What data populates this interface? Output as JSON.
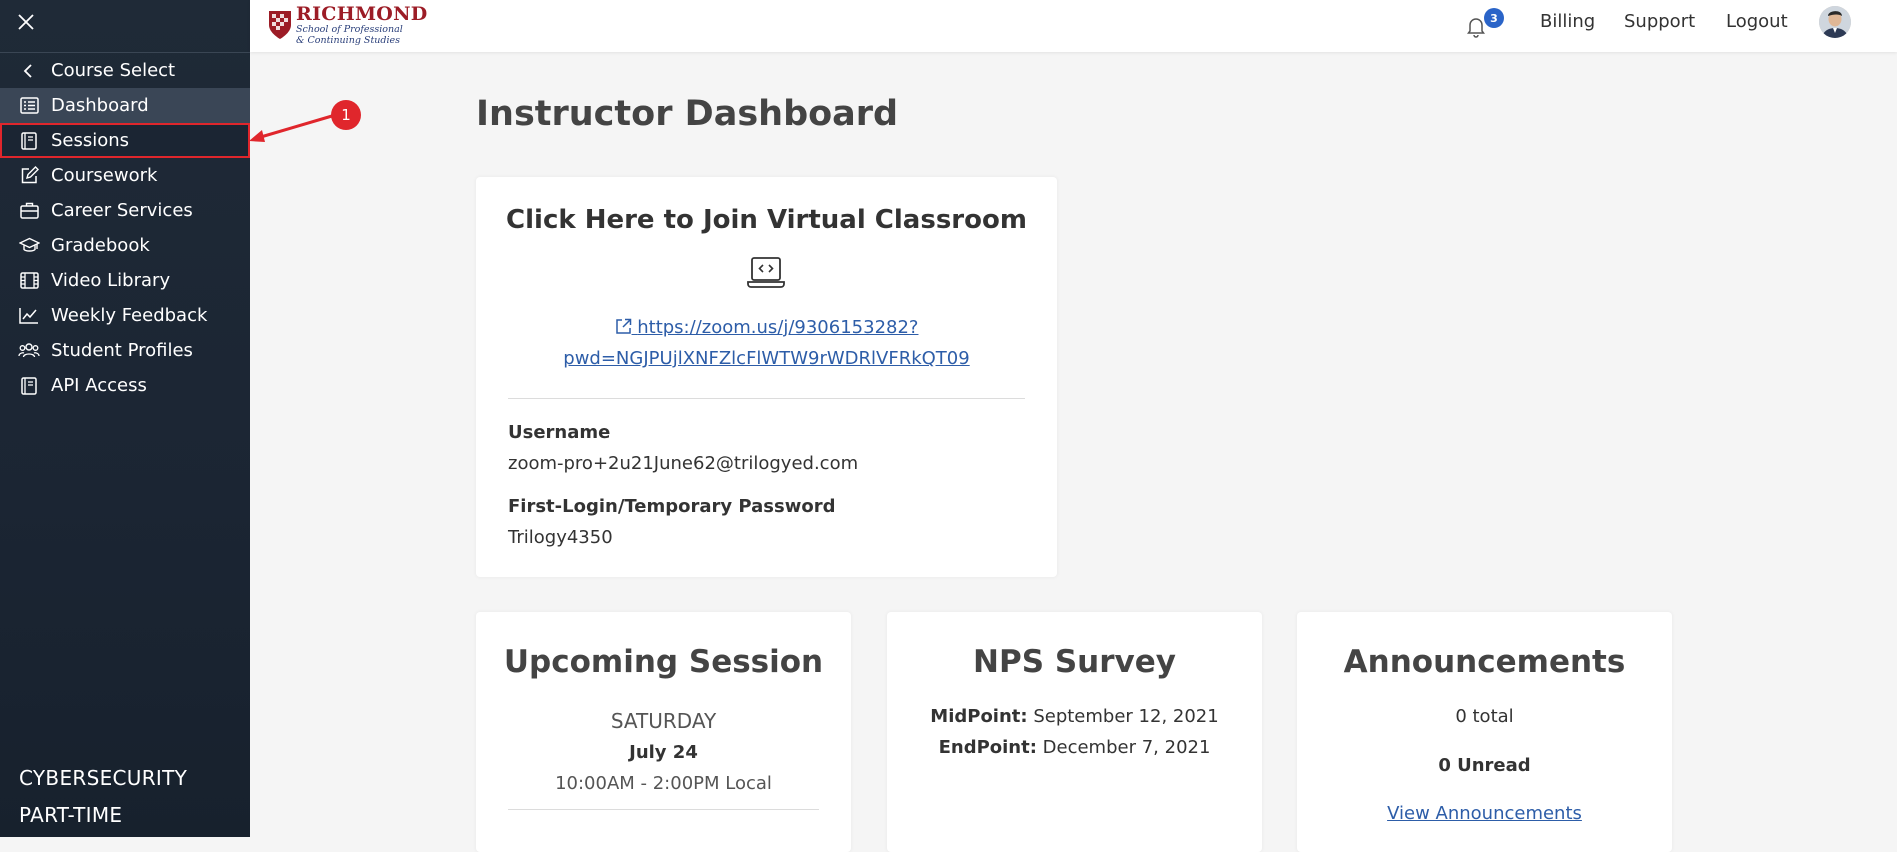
{
  "sidebar": {
    "items": [
      {
        "label": "Course Select",
        "icon": "chevron-left-icon"
      },
      {
        "label": "Dashboard",
        "icon": "list-icon"
      },
      {
        "label": "Sessions",
        "icon": "book-icon"
      },
      {
        "label": "Coursework",
        "icon": "edit-icon"
      },
      {
        "label": "Career Services",
        "icon": "briefcase-icon"
      },
      {
        "label": "Gradebook",
        "icon": "graduation-cap-icon"
      },
      {
        "label": "Video Library",
        "icon": "film-icon"
      },
      {
        "label": "Weekly Feedback",
        "icon": "chart-line-icon"
      },
      {
        "label": "Student Profiles",
        "icon": "users-icon"
      },
      {
        "label": "API Access",
        "icon": "book-icon"
      }
    ],
    "active_index": 1,
    "program_line1": "CYBERSECURITY",
    "program_line2": "PART-TIME"
  },
  "header": {
    "logo_main": "RICHMOND",
    "logo_sub1": "School of Professional",
    "logo_sub2": "& Continuing Studies",
    "notification_count": "3",
    "links": {
      "billing": "Billing",
      "support": "Support",
      "logout": "Logout"
    }
  },
  "main": {
    "title": "Instructor Dashboard",
    "virtual_classroom": {
      "heading": "Click Here to Join Virtual Classroom",
      "link_line1": "https://zoom.us/j/9306153282?",
      "link_line2": "pwd=NGJPUjlXNFZlcFlWTW9rWDRlVFRkQT09",
      "username_label": "Username",
      "username_value": "zoom-pro+2u21June62@trilogyed.com",
      "password_label": "First-Login/Temporary Password",
      "password_value": "Trilogy4350"
    },
    "upcoming_session": {
      "title": "Upcoming Session",
      "day": "SATURDAY",
      "date": "July 24",
      "time": "10:00AM - 2:00PM Local"
    },
    "nps_survey": {
      "title": "NPS Survey",
      "midpoint_label": "MidPoint:",
      "midpoint_value": "September 12, 2021",
      "endpoint_label": "EndPoint:",
      "endpoint_value": "December 7, 2021"
    },
    "announcements": {
      "title": "Announcements",
      "total": "0 total",
      "unread": "0 Unread",
      "link": "View Announcements"
    }
  },
  "annotation": {
    "number": "1",
    "color": "#e0262c"
  },
  "colors": {
    "sidebar_bg": "#1f2a37",
    "active_item": "#3a4656",
    "link": "#2d5da8",
    "badge": "#2a64c8"
  }
}
